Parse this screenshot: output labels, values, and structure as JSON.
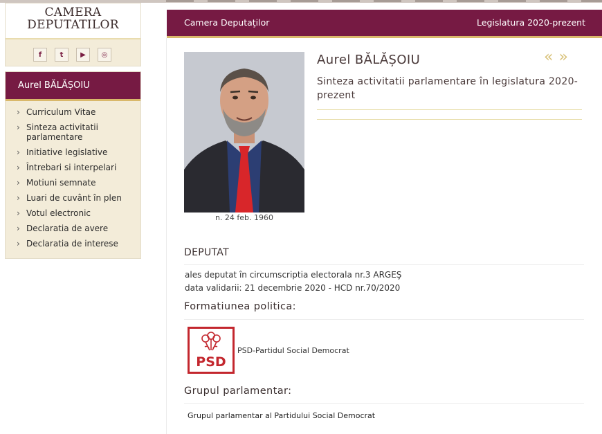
{
  "logo": {
    "line1": "CAMERA",
    "line2": "DEPUTATILOR"
  },
  "social": [
    {
      "icon": "facebook-icon",
      "glyph": "f"
    },
    {
      "icon": "twitter-icon",
      "glyph": "t"
    },
    {
      "icon": "youtube-icon",
      "glyph": "▶"
    },
    {
      "icon": "instagram-icon",
      "glyph": "◎"
    }
  ],
  "sidebar": {
    "title": "Aurel BĂLĂȘOIU",
    "items": [
      {
        "label": "Curriculum Vitae"
      },
      {
        "label": "Sinteza activitatii parlamentare"
      },
      {
        "label": "Initiative legislative"
      },
      {
        "label": "Întrebari si interpelari"
      },
      {
        "label": "Motiuni semnate"
      },
      {
        "label": "Luari de cuvânt în plen"
      },
      {
        "label": "Votul electronic"
      },
      {
        "label": "Declaratia de avere"
      },
      {
        "label": "Declaratia de interese"
      }
    ]
  },
  "header": {
    "left": "Camera Deputaţilor",
    "right": "Legislatura 2020-prezent"
  },
  "profile": {
    "name": "Aurel BĂLĂȘOIU",
    "subtitle": "Sinteza activitatii parlamentare în legislatura 2020-prezent",
    "birth": "n. 24 feb. 1960",
    "nav_prev": "«",
    "nav_next": "»"
  },
  "deputat": {
    "heading": "DEPUTAT",
    "line1": "ales deputat în circumscriptia electorala nr.3 ARGEŞ",
    "line2": "data validarii: 21 decembrie 2020 - HCD nr.70/2020"
  },
  "formatiune": {
    "heading": "Formatiunea politica:",
    "logo_text": "PSD",
    "party": "PSD-Partidul Social Democrat"
  },
  "grup": {
    "heading": "Grupul parlamentar:",
    "name": "Grupul parlamentar al Partidului Social Democrat"
  },
  "colors": {
    "brand": "#761a43",
    "gold": "#d9b86b",
    "psd_red": "#c3272e"
  }
}
